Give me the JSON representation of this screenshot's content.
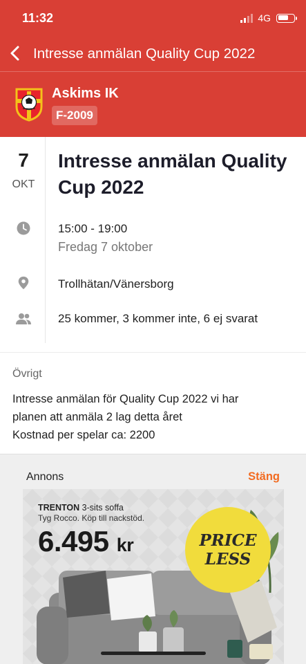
{
  "status_bar": {
    "time": "11:32",
    "network": "4G",
    "signal_bars": 2,
    "battery_level": 0.65
  },
  "nav": {
    "title": "Intresse anmälan Quality Cup 2022",
    "back_icon": "chevron-left-icon"
  },
  "team": {
    "name": "Askims IK",
    "tag": "F-2009",
    "logo_icon": "askims-ik-crest"
  },
  "event": {
    "day": "7",
    "month": "OKT",
    "title": "Intresse anmälan Quality Cup 2022",
    "time_range": "15:00 - 19:00",
    "date_full": "Fredag 7 oktober",
    "location": "Trollhätan/Vänersborg",
    "attendance": "25 kommer, 3 kommer inte, 6 ej svarat",
    "time_icon": "clock-icon",
    "location_icon": "location-pin-icon",
    "attendance_icon": "people-icon"
  },
  "other": {
    "heading": "Övrigt",
    "lines": [
      "Intresse anmälan för Quality Cup 2022 vi har",
      "planen att anmäla 2 lag detta året",
      "Kostnad per spelar ca: 2200"
    ]
  },
  "ad": {
    "label": "Annons",
    "close_label": "Stäng",
    "product_name": "TRENTON",
    "product_suffix": "3-sits soffa",
    "subline": "Tyg Rocco. Köp till nackstöd.",
    "price_number": "6.495",
    "price_unit": "kr",
    "badge_line1": "PRICE",
    "badge_line2": "LESS"
  },
  "colors": {
    "brand_red": "#d93f35",
    "ad_close": "#f26b21",
    "badge_yellow": "#f1dc3c"
  }
}
